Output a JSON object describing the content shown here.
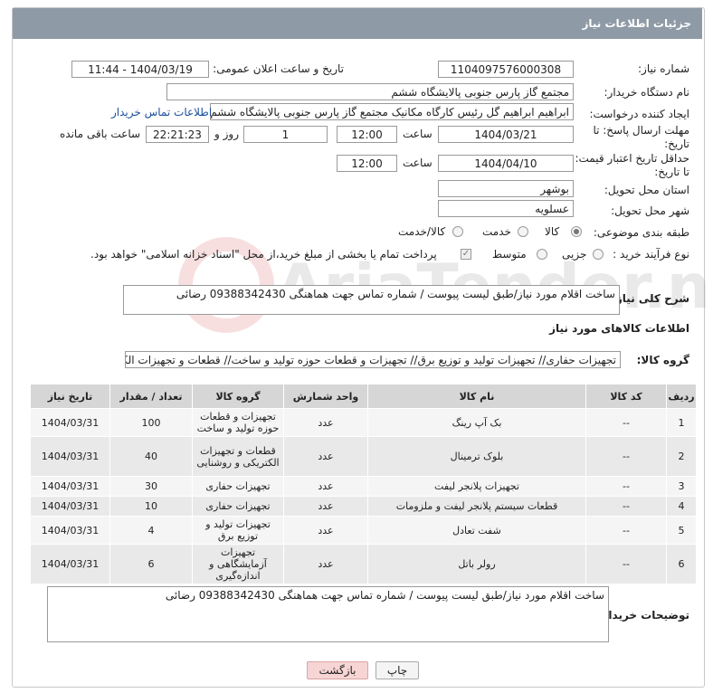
{
  "header": {
    "title": "جزئیات اطلاعات نیاز"
  },
  "fields": {
    "need_number_label": "شماره نیاز:",
    "need_number": "1104097576000308",
    "announce_label": "تاریخ و ساعت اعلان عمومی:",
    "announce_value": "1404/03/19 - 11:44",
    "buyer_org_label": "نام دستگاه خریدار:",
    "buyer_org": "مجتمع گاز پارس جنوبی  پالایشگاه ششم",
    "creator_label": "ایجاد کننده درخواست:",
    "creator": "ابراهیم ابراهیم گل رئیس کارگاه مکانیک مجتمع گاز پارس جنوبی  پالایشگاه ششم",
    "contact_link": "اطلاعات تماس خریدار",
    "deadline_label_1": "مهلت ارسال پاسخ: تا",
    "deadline_label_2": "تاریخ:",
    "deadline_date": "1404/03/21",
    "time_label": "ساعت",
    "deadline_time": "12:00",
    "days_value": "1",
    "days_label": "روز و",
    "remaining_time": "22:21:23",
    "remaining_label": "ساعت باقی مانده",
    "price_label_1": "حداقل تاریخ اعتبار قیمت:",
    "price_label_2": "تا تاریخ:",
    "price_date": "1404/04/10",
    "price_time": "12:00",
    "province_label": "استان محل تحویل:",
    "province": "بوشهر",
    "city_label": "شهر محل تحویل:",
    "city": "عسلویه",
    "category_label": "طبقه بندی موضوعی:",
    "category_options": [
      "کالا",
      "خدمت",
      "کالا/خدمت"
    ],
    "process_label": "نوع فرآیند خرید :",
    "process_options": [
      "جزیی",
      "متوسط"
    ],
    "payment_note": "پرداخت تمام یا بخشی از مبلغ خرید،از محل \"اسناد خزانه اسلامی\" خواهد بود."
  },
  "description": {
    "label": "شرح کلی نیاز:",
    "value": "ساخت اقلام مورد نیاز/طبق لیست پیوست / شماره تماس جهت هماهنگی 09388342430 رضائی"
  },
  "goods": {
    "section_title": "اطلاعات کالاهای مورد نیاز",
    "group_label": "گروه کالا:",
    "group_value": "تجهیزات حفاری// تجهیزات تولید و توزیع برق// تجهیزات و قطعات حوزه تولید و ساخت// قطعات و تجهیزات الکتریکی",
    "columns": [
      "ردیف",
      "کد کالا",
      "نام کالا",
      "واحد شمارش",
      "گروه کالا",
      "تعداد / مقدار",
      "تاریخ نیاز"
    ],
    "rows": [
      [
        "1",
        "--",
        "بک آپ رینگ",
        "عدد",
        "تجهیزات و قطعات حوزه تولید و ساخت",
        "100",
        "1404/03/31"
      ],
      [
        "2",
        "--",
        "بلوک ترمینال",
        "عدد",
        "قطعات و تجهیزات الکتریکی و روشنایی",
        "40",
        "1404/03/31"
      ],
      [
        "3",
        "--",
        "تجهیزات پلانجر لیفت",
        "عدد",
        "تجهیزات حفاری",
        "30",
        "1404/03/31"
      ],
      [
        "4",
        "--",
        "قطعات سیستم پلانجر لیفت و ملزومات",
        "عدد",
        "تجهیزات حفاری",
        "10",
        "1404/03/31"
      ],
      [
        "5",
        "--",
        "شفت تعادل",
        "عدد",
        "تجهیزات تولید و توزیع برق",
        "4",
        "1404/03/31"
      ],
      [
        "6",
        "--",
        "رولر باتل",
        "عدد",
        "تجهیزات آزمایشگاهی و اندازه‌گیری",
        "6",
        "1404/03/31"
      ]
    ]
  },
  "buyer_notes": {
    "label": "توضیحات خریدار:",
    "value": "ساخت اقلام مورد نیاز/طبق لیست پیوست / شماره تماس جهت هماهنگی 09388342430 رضائی"
  },
  "buttons": {
    "print": "چاپ",
    "back": "بازگشت"
  },
  "watermark": "AriaTender.net"
}
